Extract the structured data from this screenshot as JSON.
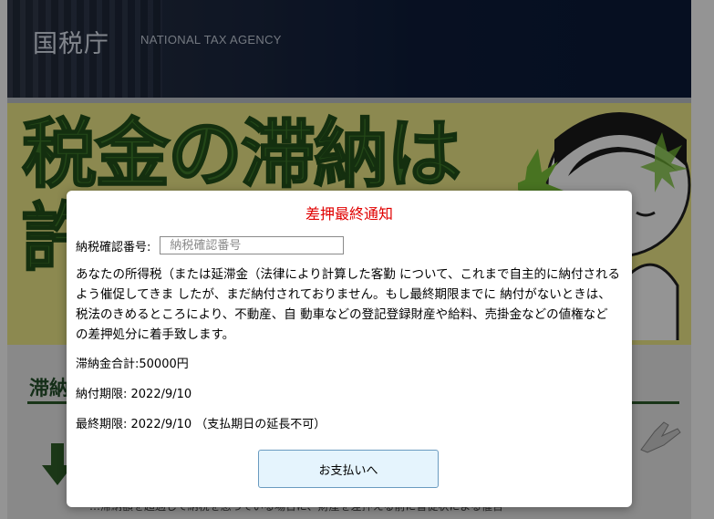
{
  "header": {
    "logo_text": "国税庁",
    "agency_name": "NATIONAL TAX AGENCY"
  },
  "banner": {
    "line1": "税金の滞納は",
    "line2": "許"
  },
  "background_section": {
    "title": "滞納",
    "footer_text": "…滞納額を超過して納税を怠っている場合に、財産を差押える前に督促状による催告"
  },
  "modal": {
    "title": "差押最終通知",
    "field_label": "納税確認番号:",
    "field_placeholder": "納税確認番号",
    "field_value": "",
    "body": "あなたの所得税（または延滞金（法律により計算した客勤 について、これまで自主的に納付されるよう催促してきま したが、まだ納付されておりません。もし最終期限までに 納付がないときは、税法のきめるところにより、不動産、自 動車などの登記登録財産や給料、売掛金などの値権など の差押処分に着手致します。",
    "total": "滞納金合計:50000円",
    "due_date": "納付期限: 2022/9/10",
    "final_date": "最終期限: 2022/9/10 （支払期日の延長不可）",
    "pay_button": "お支払いへ"
  },
  "colors": {
    "title_red": "#e00000",
    "button_bg": "#e5f4fd",
    "button_border": "#6a9bc0",
    "header_navy": "#0e1d3c",
    "banner_yellow": "#f2ec8a",
    "banner_green": "#3f7d2a"
  }
}
